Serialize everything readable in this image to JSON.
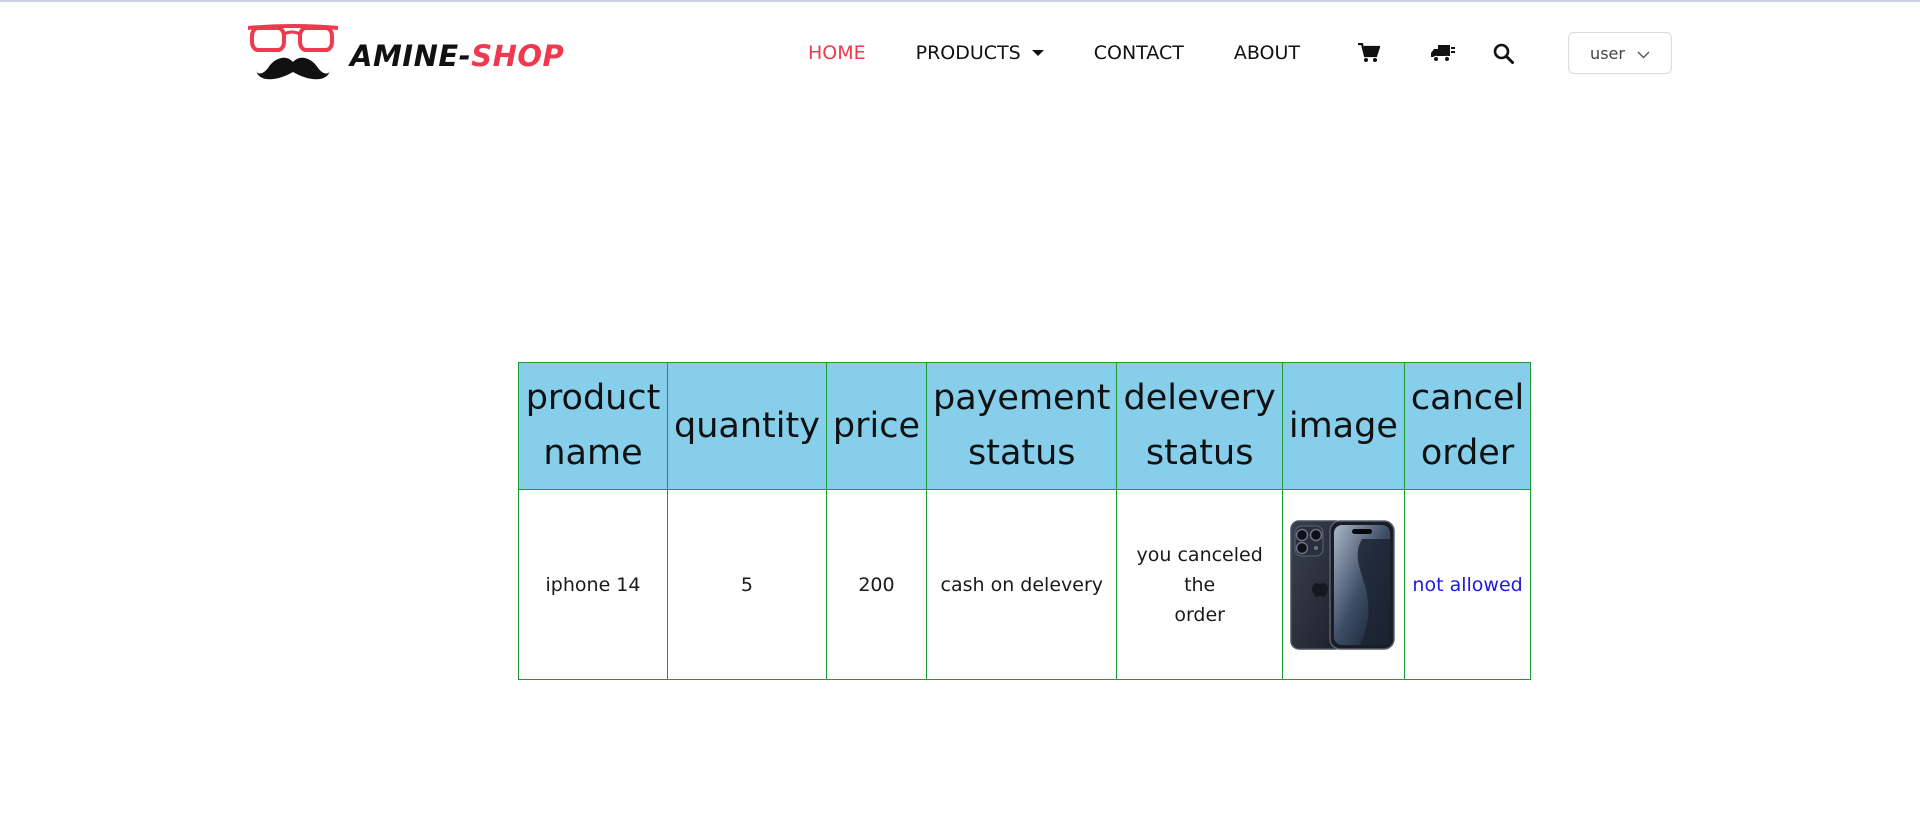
{
  "brand": {
    "part1": "AMINE-",
    "part2": "SHOP"
  },
  "nav": {
    "home": "HOME",
    "products": "PRODUCTS",
    "contact": "CONTACT",
    "about": "ABOUT"
  },
  "icons": [
    "cart-icon",
    "truck-icon",
    "search-icon"
  ],
  "user_menu": {
    "label": "user"
  },
  "colors": {
    "accent": "#f0394f",
    "header_bg": "#87ceeb",
    "border": "#1e9a33",
    "link": "#1a1ae0"
  },
  "orders_table": {
    "headers": [
      [
        "product",
        "name"
      ],
      [
        "quantity"
      ],
      [
        "price"
      ],
      [
        "payement",
        "status"
      ],
      [
        "delevery",
        "status"
      ],
      [
        "image"
      ],
      [
        "cancel",
        "order"
      ]
    ],
    "rows": [
      {
        "product_name": "iphone 14",
        "quantity": "5",
        "price": "200",
        "payment_status": "cash on delevery",
        "delivery_status_line1": "you canceled the",
        "delivery_status_line2": "order",
        "image": "iphone-image",
        "cancel": "not allowed"
      }
    ]
  }
}
